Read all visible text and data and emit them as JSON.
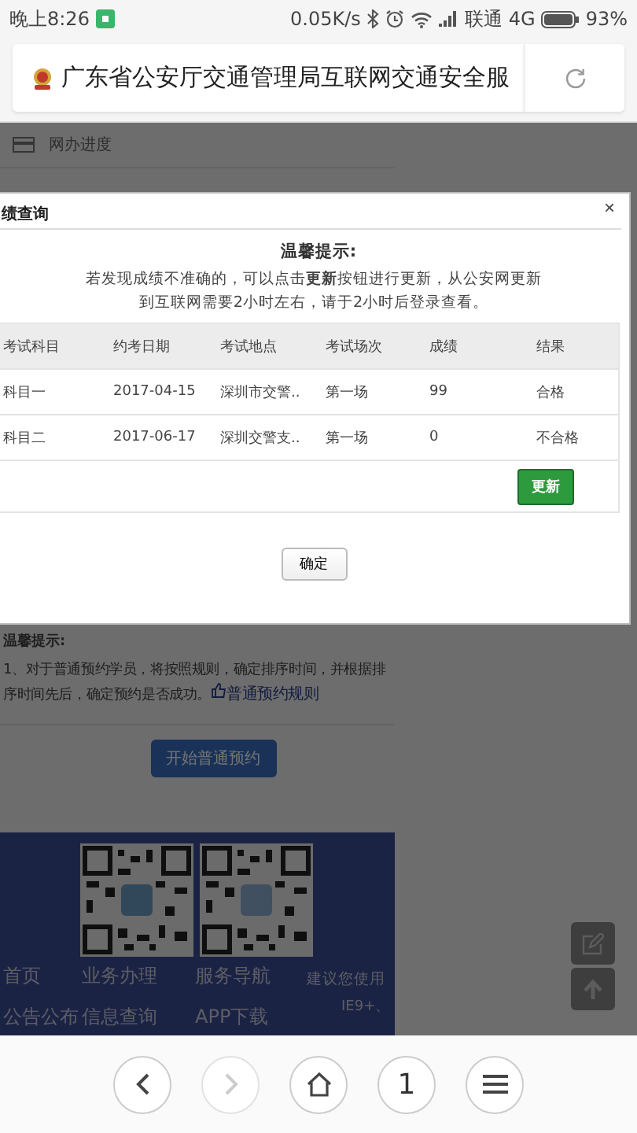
{
  "status_bar": {
    "time": "晚上8:26",
    "speed": "0.05K/s",
    "carrier": "联通",
    "network": "4G",
    "battery": "93%"
  },
  "address_bar": {
    "title": "广东省公安厅交通管理局互联网交通安全服"
  },
  "page": {
    "menu_item": "网办进度",
    "notice": {
      "title": "温馨提示:",
      "text": "1、对于普通预约学员，将按照规则，确定排序时间，并根据排序时间先后，确定预约是否成功。",
      "link": "普通预约规则"
    },
    "start_button": "开始普通预约",
    "footer": {
      "links": [
        "首页",
        "业务办理",
        "服务导航",
        "公告公布",
        "信息查询",
        "APP下载"
      ],
      "browser_note": "建议您使用",
      "browser_note_2": "IE9+、"
    }
  },
  "dialog": {
    "title": "绩查询",
    "close": "×",
    "tip_title": "温馨提示:",
    "tip": "若发现成绩不准确的，可以点击**更新**按钮进行更新，从公安网更新到互联网需要2小时左右，请于2小时后登录查看。",
    "columns": [
      "考试科目",
      "约考日期",
      "考试地点",
      "考试场次",
      "成绩",
      "结果"
    ],
    "rows": [
      {
        "cells": [
          "科目一",
          "2017-04-15",
          "深圳市交警..",
          "第一场",
          "99",
          "合格"
        ]
      },
      {
        "cells": [
          "科目二",
          "2017-06-17",
          "深圳交警支..",
          "第一场",
          "0",
          "不合格"
        ]
      }
    ],
    "update_button": "更新",
    "ok_button": "确定"
  },
  "nav": {
    "tabs": "1",
    "forward_disabled": true
  }
}
